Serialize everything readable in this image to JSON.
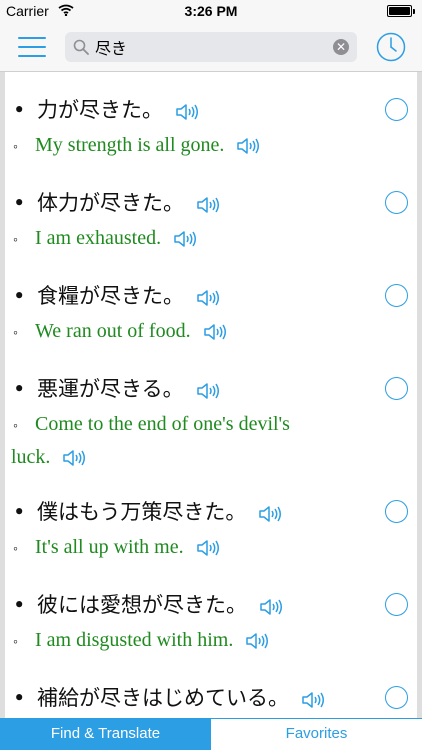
{
  "status_bar": {
    "carrier": "Carrier",
    "time": "3:26 PM"
  },
  "search": {
    "value": "尽き"
  },
  "entries": [
    {
      "jp": "力が尽きた。",
      "en": "My strength is all gone."
    },
    {
      "jp": "体力が尽きた。",
      "en": "I am exhausted."
    },
    {
      "jp": "食糧が尽きた。",
      "en": "We ran out of food."
    },
    {
      "jp": "悪運が尽きる。",
      "en": "Come to the end of one's devil's luck."
    },
    {
      "jp": "僕はもう万策尽きた。",
      "en": "It's all up with me."
    },
    {
      "jp": "彼には愛想が尽きた。",
      "en": "I am disgusted with him."
    },
    {
      "jp": "補給が尽きはじめている。",
      "en": ""
    }
  ],
  "tabs": {
    "find": "Find & Translate",
    "favorites": "Favorites"
  },
  "colors": {
    "accent": "#2c9ee4",
    "english_text": "#1f8a1f"
  },
  "icons": [
    "menu-icon",
    "search-icon",
    "clear-icon",
    "clock-icon",
    "speaker-icon",
    "select-circle-icon"
  ]
}
